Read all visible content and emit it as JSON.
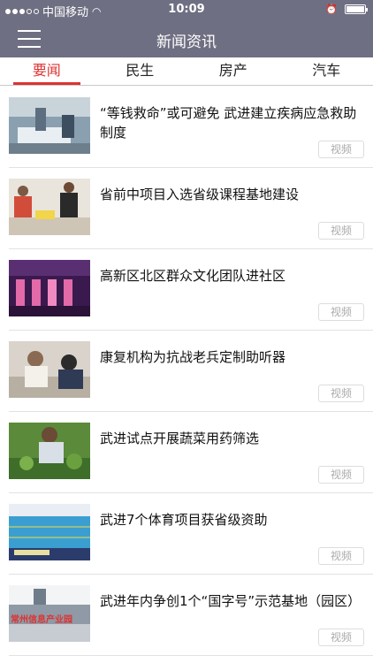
{
  "status_bar": {
    "carrier": "中国移动",
    "time": "10:09"
  },
  "header": {
    "title": "新闻资讯"
  },
  "tabs": [
    {
      "label": "要闻",
      "active": true
    },
    {
      "label": "民生",
      "active": false
    },
    {
      "label": "房产",
      "active": false
    },
    {
      "label": "汽车",
      "active": false
    }
  ],
  "news": [
    {
      "title": "“等钱救命”或可避免 武进建立疾病应急救助制度",
      "badge": "视频"
    },
    {
      "title": "省前中项目入选省级课程基地建设",
      "badge": "视频"
    },
    {
      "title": "高新区北区群众文化团队进社区",
      "badge": "视频"
    },
    {
      "title": "康复机构为抗战老兵定制助听器",
      "badge": "视频"
    },
    {
      "title": "武进试点开展蔬菜用药筛选",
      "badge": "视频"
    },
    {
      "title": "武进7个体育项目获省级资助",
      "badge": "视频"
    },
    {
      "title": "武进年内争创1个“国字号”示范基地（园区）",
      "badge": "视频"
    }
  ],
  "thumb_overlay_text": "常州信息产业园"
}
